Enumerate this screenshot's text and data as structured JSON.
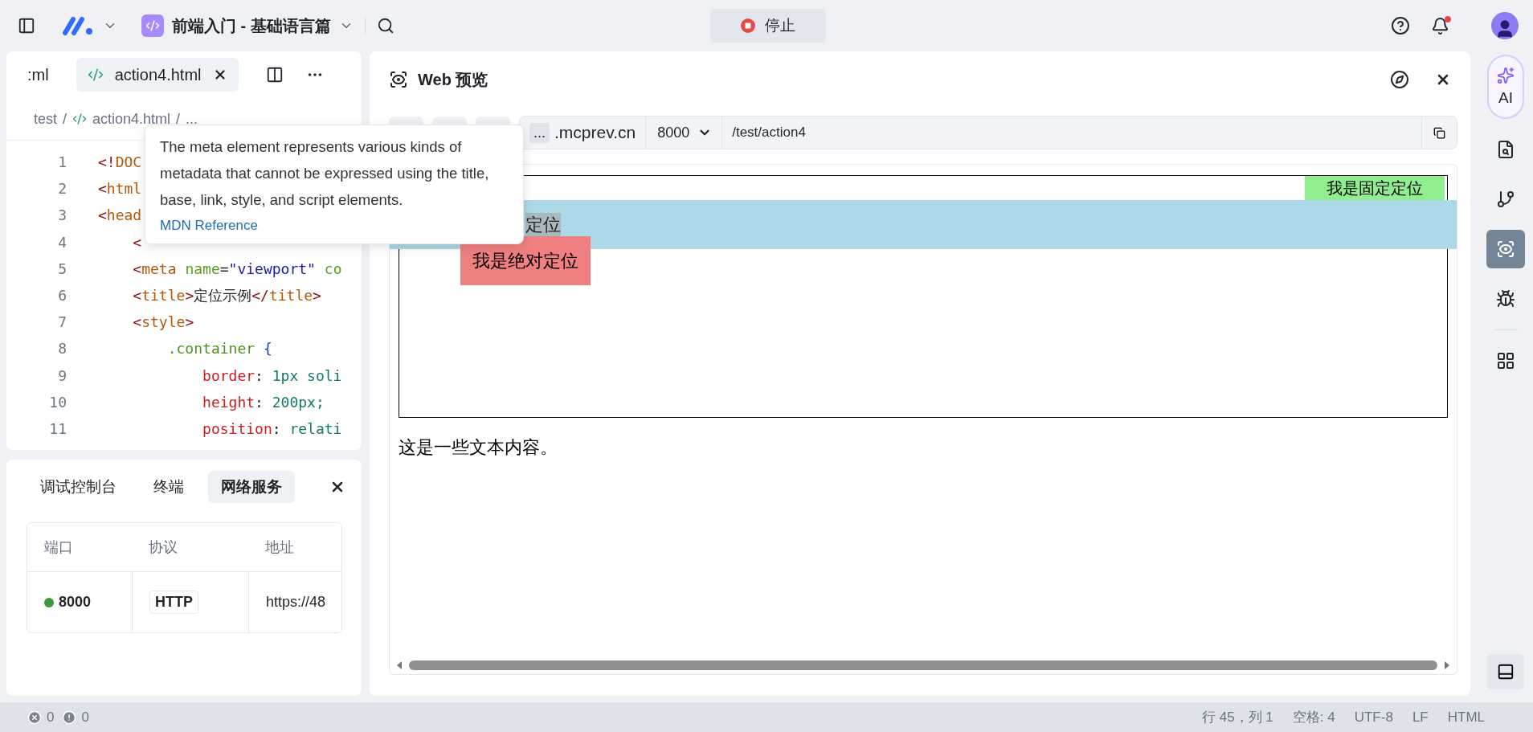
{
  "top_bar": {
    "project_title": "前端入门 - 基础语言篇",
    "stop_button": "停止",
    "notification_unread": true
  },
  "editor": {
    "tabs": [
      {
        "label": ":ml",
        "selected": false
      },
      {
        "label": "action4.html",
        "selected": true
      }
    ],
    "breadcrumb": {
      "folder": "test",
      "separator": "/",
      "file": "action4.html",
      "more": "..."
    },
    "lines": [
      {
        "number": "1",
        "tokens": [
          {
            "kind": "punct",
            "text": "<!"
          },
          {
            "kind": "tag",
            "text": "DOC"
          }
        ]
      },
      {
        "number": "2",
        "tokens": [
          {
            "kind": "punct",
            "text": "<"
          },
          {
            "kind": "tag",
            "text": "html"
          }
        ]
      },
      {
        "number": "3",
        "tokens": [
          {
            "kind": "punct",
            "text": "<"
          },
          {
            "kind": "tag",
            "text": "head"
          }
        ]
      },
      {
        "number": "4",
        "tokens": [
          {
            "kind": "punct",
            "text": "    <"
          }
        ]
      },
      {
        "number": "5",
        "tokens": [
          {
            "kind": "punct",
            "text": "    <"
          },
          {
            "kind": "tag",
            "text": "meta"
          },
          {
            "kind": "attr",
            "text": " name"
          },
          {
            "kind": "text",
            "text": "="
          },
          {
            "kind": "string",
            "text": "\"viewport\""
          },
          {
            "kind": "attr",
            "text": " co"
          }
        ]
      },
      {
        "number": "6",
        "tokens": [
          {
            "kind": "punct",
            "text": "    <"
          },
          {
            "kind": "tag",
            "text": "title"
          },
          {
            "kind": "punct",
            "text": ">"
          },
          {
            "kind": "text",
            "text": "定位示例"
          },
          {
            "kind": "punct",
            "text": "</"
          },
          {
            "kind": "tag",
            "text": "title"
          },
          {
            "kind": "punct",
            "text": ">"
          }
        ]
      },
      {
        "number": "7",
        "tokens": [
          {
            "kind": "punct",
            "text": "    <"
          },
          {
            "kind": "tag",
            "text": "style"
          },
          {
            "kind": "punct",
            "text": ">"
          }
        ]
      },
      {
        "number": "8",
        "tokens": [
          {
            "kind": "selector",
            "text": "        .container"
          },
          {
            "kind": "brace",
            "text": " {"
          }
        ]
      },
      {
        "number": "9",
        "tokens": [
          {
            "kind": "prop",
            "text": "            border"
          },
          {
            "kind": "text",
            "text": ":"
          },
          {
            "kind": "value",
            "text": " 1px soli"
          }
        ]
      },
      {
        "number": "10",
        "tokens": [
          {
            "kind": "prop",
            "text": "            height"
          },
          {
            "kind": "text",
            "text": ":"
          },
          {
            "kind": "value",
            "text": " 200px;"
          }
        ]
      },
      {
        "number": "11",
        "tokens": [
          {
            "kind": "prop",
            "text": "            position"
          },
          {
            "kind": "text",
            "text": ":"
          },
          {
            "kind": "value",
            "text": " relati"
          }
        ]
      }
    ]
  },
  "tooltip": {
    "text": "The meta element represents various kinds of metadata that cannot be expressed using the title, base, link, style, and script elements.",
    "link": "MDN Reference"
  },
  "bottom_panel": {
    "tabs": [
      {
        "label": "调试控制台",
        "selected": false
      },
      {
        "label": "终端",
        "selected": false
      },
      {
        "label": "网络服务",
        "selected": true
      }
    ],
    "columns": [
      "端口",
      "协议",
      "地址"
    ],
    "rows": [
      {
        "port": "8000",
        "color": "#3a9a3a",
        "protocol": "HTTP",
        "address": "https://48"
      }
    ]
  },
  "preview": {
    "title": "Web 预览",
    "host_prefix": "...",
    "host": ".mcprev.cn",
    "port": "8000",
    "path": "/test/action4",
    "page": {
      "fixed_text": "我是固定定位",
      "sticky_text": "定位",
      "absolute_text": "我是绝对定位",
      "body_text": "这是一些文本内容。"
    }
  },
  "rail": {
    "ai_label": "AI",
    "items": [
      {
        "kind": "file-search",
        "selected": false
      },
      {
        "kind": "branch",
        "selected": false
      },
      {
        "kind": "preview",
        "selected": true
      },
      {
        "kind": "debug",
        "selected": false
      }
    ]
  },
  "status_bar": {
    "errors": "0",
    "warnings": "0",
    "items": [
      "行 45，列 1",
      "空格: 4",
      "UTF-8",
      "LF",
      "HTML"
    ]
  }
}
